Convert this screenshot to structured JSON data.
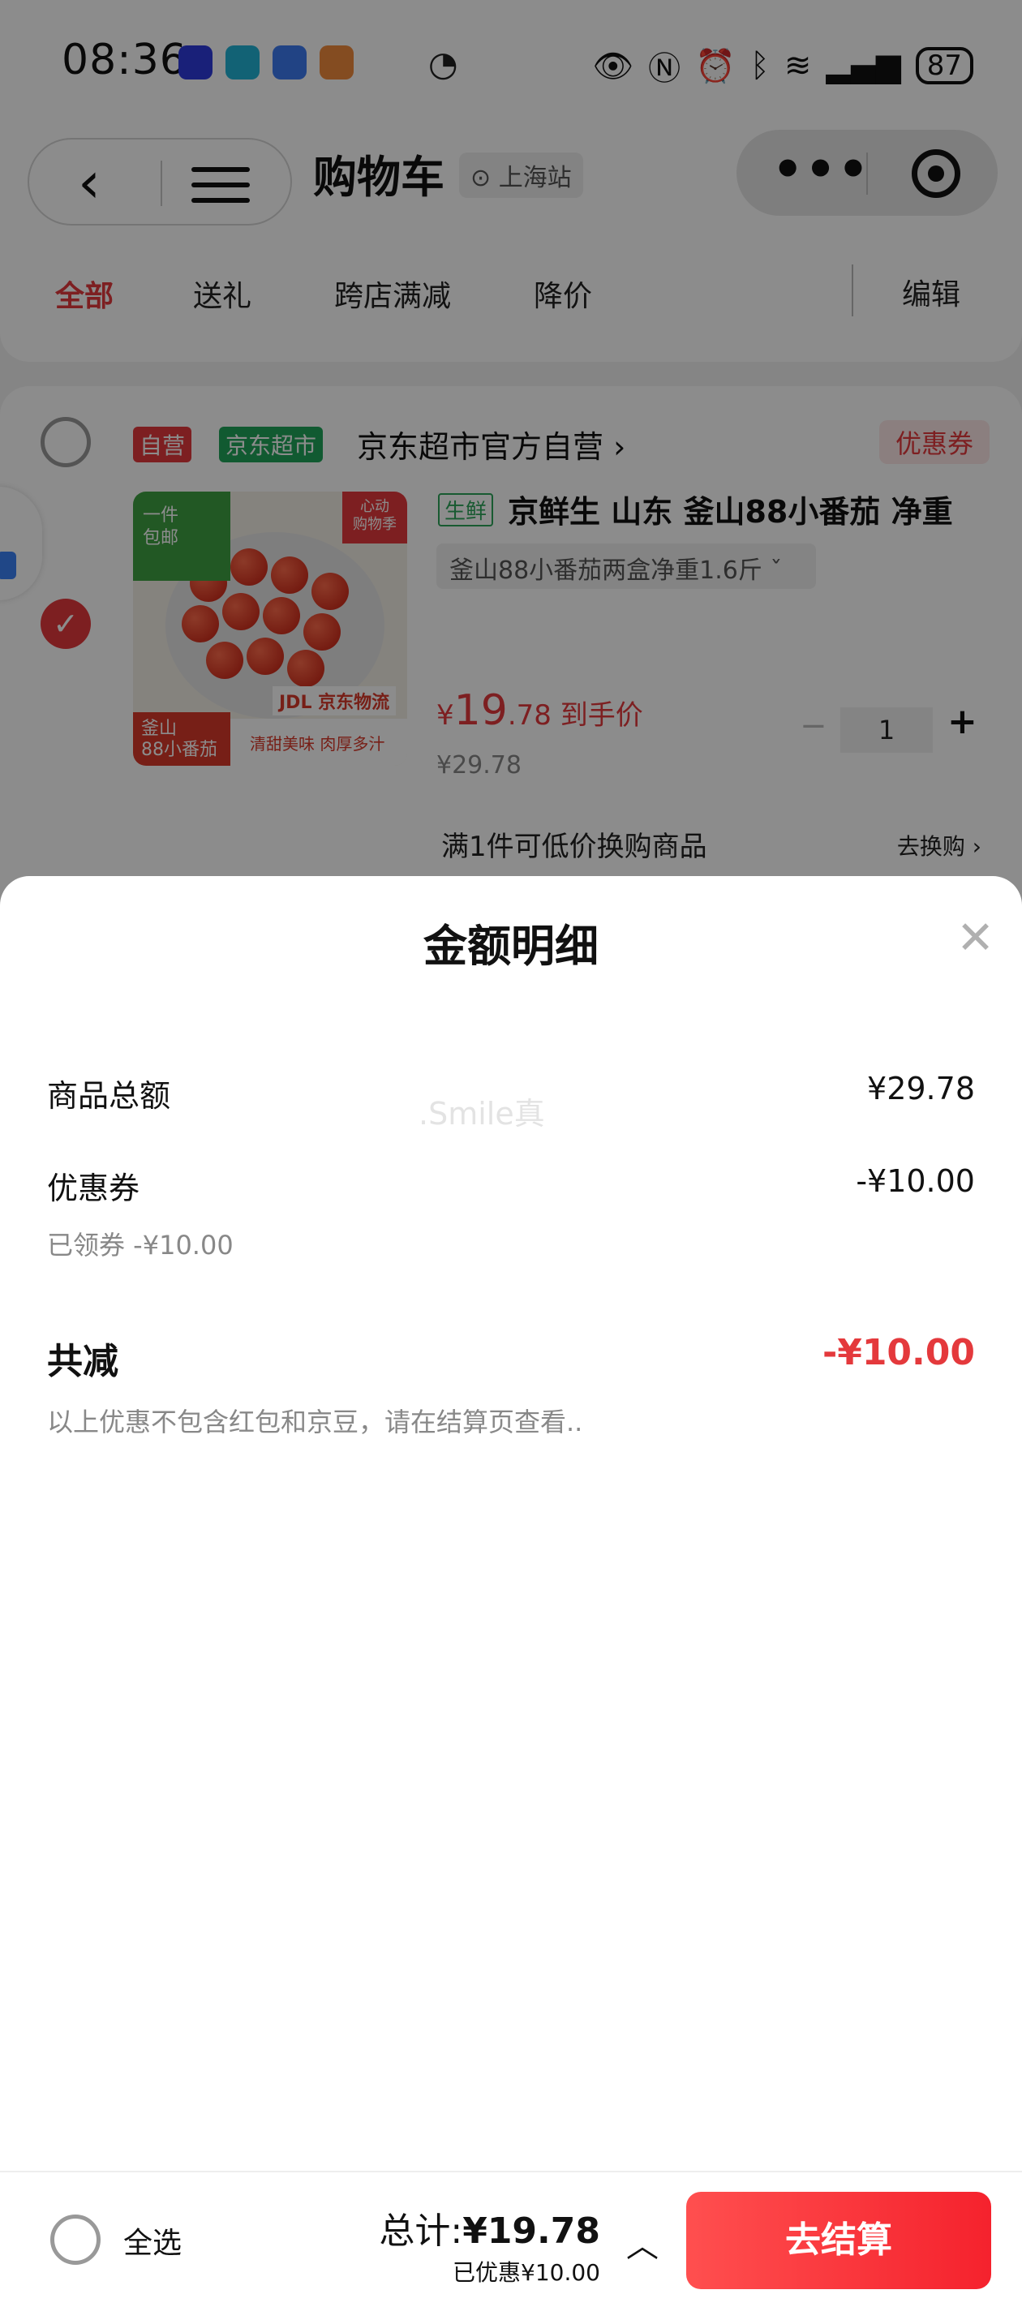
{
  "status_bar": {
    "time": "08:36",
    "battery": "87"
  },
  "header": {
    "title": "购物车",
    "location": "上海站"
  },
  "tabs": [
    {
      "label": "全部",
      "active": true
    },
    {
      "label": "送礼"
    },
    {
      "label": "跨店满减"
    },
    {
      "label": "降价"
    }
  ],
  "tab_edit": "编辑",
  "shop": {
    "tag_self": "自营",
    "tag_supermarket": "京东超市",
    "name": "京东超市官方自营 ›",
    "coupon": "优惠券"
  },
  "product": {
    "image_text": {
      "top_left": "一件\n包邮",
      "top_right": "心动\n购物季",
      "badge": "釜山\n88小番茄",
      "jdl": "JDL 京东物流",
      "slogan": "清甜美味 肉厚多汁"
    },
    "fresh_tag": "生鲜",
    "title": "京鲜生 山东 釜山88小番茄 净重",
    "spec": "釜山88小番茄两盒净重1.6斤  ˇ",
    "price_symbol": "¥",
    "price_int": "19",
    "price_dec": ".78",
    "price_suffix": "到手价",
    "price_original": "¥29.78",
    "quantity": "1",
    "swap_text": "满1件可低价换购商品",
    "swap_link": "去换购 ›"
  },
  "sheet": {
    "title": "金额明细",
    "rows": {
      "goods_total_label": "商品总额",
      "goods_total_value": "¥29.78",
      "coupon_label": "优惠券",
      "coupon_value": "-¥10.00",
      "coupon_sub": "已领券 -¥10.00",
      "reduce_label": "共减",
      "reduce_value": "-¥10.00",
      "note": "以上优惠不包含红包和京豆，请在结算页查看.."
    },
    "watermark": ".Smile真"
  },
  "bottom_bar": {
    "select_all": "全选",
    "total_label": "总计:",
    "total_amount": "¥19.78",
    "discount": "已优惠¥10.00",
    "checkout": "去结算"
  },
  "colors": {
    "accent_red": "#e4393c",
    "supermarket_green": "#1fa45a"
  }
}
